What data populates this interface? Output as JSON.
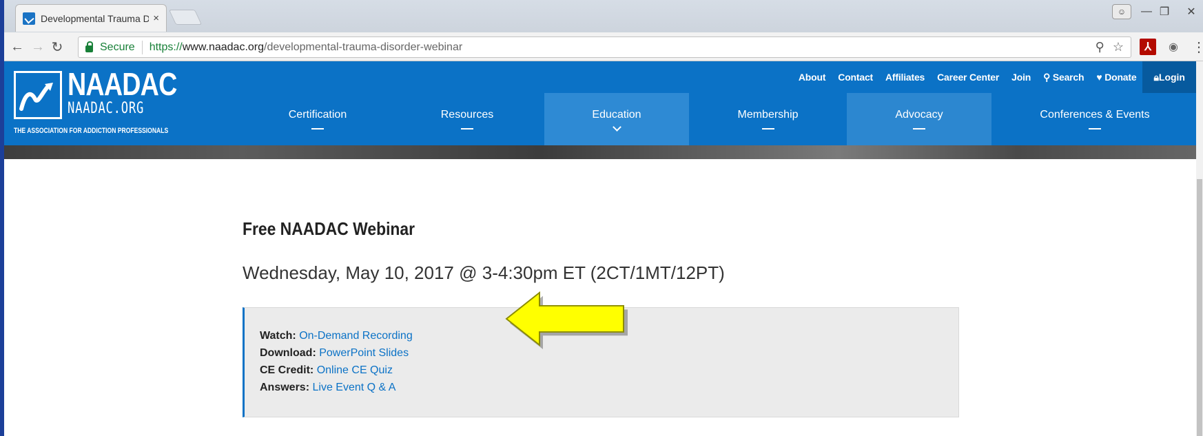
{
  "browser": {
    "tab_title": "Developmental Trauma D",
    "tab_close": "×",
    "secure_label": "Secure",
    "url_scheme": "https://",
    "url_host": "www.naadac.org",
    "url_path": "/developmental-trauma-disorder-webinar"
  },
  "site": {
    "logo": {
      "title": "NAADAC",
      "url": "NAADAC.ORG",
      "tagline": "THE ASSOCIATION FOR ADDICTION PROFESSIONALS"
    },
    "utility_nav": [
      "About",
      "Contact",
      "Affiliates",
      "Career Center",
      "Join",
      "Search",
      "Donate",
      "Login"
    ],
    "main_nav": [
      {
        "label": "Certification",
        "state": "normal"
      },
      {
        "label": "Resources",
        "state": "normal"
      },
      {
        "label": "Education",
        "state": "active"
      },
      {
        "label": "Membership",
        "state": "normal"
      },
      {
        "label": "Advocacy",
        "state": "hover"
      },
      {
        "label": "Conferences & Events",
        "state": "normal"
      }
    ]
  },
  "main": {
    "title": "Free NAADAC Webinar",
    "date": "Wednesday, May 10, 2017 @ 3-4:30pm ET (2CT/1MT/12PT)",
    "links": [
      {
        "label": "Watch:",
        "link": "On-Demand Recording"
      },
      {
        "label": "Download:",
        "link": "PowerPoint Slides"
      },
      {
        "label": "CE Credit:",
        "link": "Online CE Quiz"
      },
      {
        "label": "Answers:",
        "link": "Live Event Q & A"
      }
    ]
  },
  "colors": {
    "brand_blue": "#0b72c6",
    "arrow_yellow": "#ffff00"
  }
}
